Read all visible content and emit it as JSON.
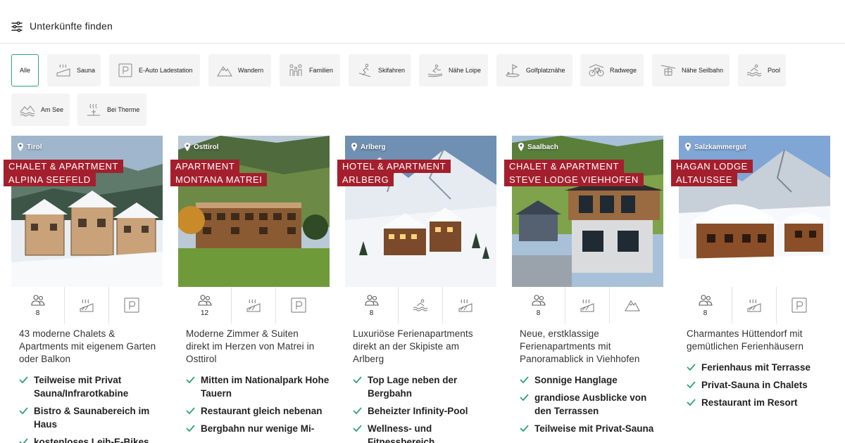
{
  "header": {
    "title": "Unterkünfte finden",
    "filter_icon": "sliders-icon"
  },
  "colors": {
    "accent_green": "#2fa37a",
    "label_red": "#a41f2d",
    "chip_bg": "#f4f4f4"
  },
  "chips": [
    {
      "label": "Alle",
      "icon": "",
      "active": true
    },
    {
      "label": "Sauna",
      "icon": "sauna-icon"
    },
    {
      "label": "E-Auto Ladestation",
      "icon": "parking-icon"
    },
    {
      "label": "Wandern",
      "icon": "mountain-icon"
    },
    {
      "label": "Familien",
      "icon": "family-icon"
    },
    {
      "label": "Skifahren",
      "icon": "ski-icon"
    },
    {
      "label": "Nähe Loipe",
      "icon": "crosscountry-icon"
    },
    {
      "label": "Golfplatznähe",
      "icon": "golf-icon"
    },
    {
      "label": "Radwege",
      "icon": "bike-icon"
    },
    {
      "label": "Nähe Seilbahn",
      "icon": "cablecar-icon"
    },
    {
      "label": "Pool",
      "icon": "pool-icon"
    },
    {
      "label": "Am See",
      "icon": "lake-icon"
    },
    {
      "label": "Bei Therme",
      "icon": "thermal-icon"
    }
  ],
  "cards": [
    {
      "region": "Tirol",
      "name_lines": [
        "CHALET & APARTMENT",
        "ALPINA SEEFELD"
      ],
      "persons": "8",
      "amenities": [
        "persons-icon",
        "sauna-icon",
        "parking-icon"
      ],
      "description": "43 moderne Chalets & Apartments mit eigenem Garten oder Balkon",
      "features": [
        "Teilweise mit Privat Sauna/Infrarotkabine",
        "Bistro & Saunabereich im Haus",
        "kostenloses Leih-E-Bikes"
      ]
    },
    {
      "region": "Osttirol",
      "name_lines": [
        "APARTMENT",
        "MONTANA MATREI"
      ],
      "persons": "12",
      "amenities": [
        "persons-icon",
        "sauna-icon",
        "parking-icon"
      ],
      "description": "Moderne Zimmer & Suiten direkt im Herzen von Matrei in Osttirol",
      "features": [
        "Mitten im Nationalpark Hohe Tauern",
        "Restaurant gleich nebenan",
        "Bergbahn nur wenige Mi-"
      ]
    },
    {
      "region": "Arlberg",
      "name_lines": [
        "HOTEL & APARTMENT",
        "ARLBERG"
      ],
      "persons": "8",
      "amenities": [
        "persons-icon",
        "pool-icon",
        "sauna-icon"
      ],
      "description": "Luxuriöse Ferienapartments direkt an der Skipiste am Arlberg",
      "features": [
        "Top Lage neben der Bergbahn",
        "Beheizter Infinity-Pool",
        "Wellness- und Fitnessbereich"
      ]
    },
    {
      "region": "Saalbach",
      "name_lines": [
        "CHALET & APARTMENT",
        "STEVE LODGE VIEHHOFEN"
      ],
      "persons": "8",
      "amenities": [
        "persons-icon",
        "sauna-icon",
        "mountain-icon"
      ],
      "description": "Neue, erstklassige Ferienapartments mit Panoramablick in Viehhofen",
      "features": [
        "Sonnige Hanglage",
        "grandiose Ausblicke von den Terrassen",
        "Teilweise mit Privat-Sauna"
      ]
    },
    {
      "region": "Salzkammergut",
      "name_lines": [
        "HAGAN LODGE",
        "ALTAUSSEE"
      ],
      "persons": "8",
      "amenities": [
        "persons-icon",
        "sauna-icon",
        "parking-icon"
      ],
      "description": "Charmantes Hüttendorf mit gemütlichen Ferienhäusern",
      "features": [
        "Ferienhaus mit Terrasse",
        "Privat-Sauna in Chalets",
        "Restaurant im Resort"
      ]
    }
  ]
}
